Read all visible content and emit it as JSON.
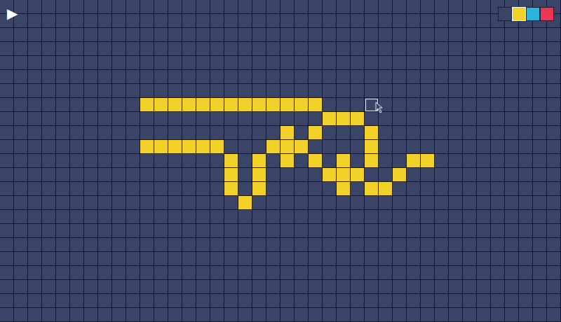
{
  "play_button": "▶",
  "palette": [
    {
      "color": "#3a4466",
      "selected": false
    },
    {
      "color": "#f2d12b",
      "selected": true
    },
    {
      "color": "#2bb5dc",
      "selected": false
    },
    {
      "color": "#ef3556",
      "selected": false
    }
  ],
  "grid": {
    "cols": 40,
    "rows": 23,
    "cells": [
      {
        "row": 7,
        "col": 10,
        "color": "#f2d12b"
      },
      {
        "row": 7,
        "col": 11,
        "color": "#f2d12b"
      },
      {
        "row": 7,
        "col": 12,
        "color": "#f2d12b"
      },
      {
        "row": 7,
        "col": 13,
        "color": "#f2d12b"
      },
      {
        "row": 7,
        "col": 14,
        "color": "#f2d12b"
      },
      {
        "row": 7,
        "col": 15,
        "color": "#f2d12b"
      },
      {
        "row": 7,
        "col": 16,
        "color": "#f2d12b"
      },
      {
        "row": 7,
        "col": 17,
        "color": "#f2d12b"
      },
      {
        "row": 7,
        "col": 18,
        "color": "#f2d12b"
      },
      {
        "row": 7,
        "col": 19,
        "color": "#f2d12b"
      },
      {
        "row": 7,
        "col": 20,
        "color": "#f2d12b"
      },
      {
        "row": 7,
        "col": 21,
        "color": "#f2d12b"
      },
      {
        "row": 7,
        "col": 22,
        "color": "#f2d12b"
      },
      {
        "row": 8,
        "col": 23,
        "color": "#f2d12b"
      },
      {
        "row": 8,
        "col": 24,
        "color": "#f2d12b"
      },
      {
        "row": 8,
        "col": 25,
        "color": "#f2d12b"
      },
      {
        "row": 9,
        "col": 20,
        "color": "#f2d12b"
      },
      {
        "row": 9,
        "col": 22,
        "color": "#f2d12b"
      },
      {
        "row": 9,
        "col": 26,
        "color": "#f2d12b"
      },
      {
        "row": 10,
        "col": 10,
        "color": "#f2d12b"
      },
      {
        "row": 10,
        "col": 11,
        "color": "#f2d12b"
      },
      {
        "row": 10,
        "col": 12,
        "color": "#f2d12b"
      },
      {
        "row": 10,
        "col": 13,
        "color": "#f2d12b"
      },
      {
        "row": 10,
        "col": 14,
        "color": "#f2d12b"
      },
      {
        "row": 10,
        "col": 15,
        "color": "#f2d12b"
      },
      {
        "row": 10,
        "col": 19,
        "color": "#f2d12b"
      },
      {
        "row": 10,
        "col": 20,
        "color": "#f2d12b"
      },
      {
        "row": 10,
        "col": 21,
        "color": "#f2d12b"
      },
      {
        "row": 10,
        "col": 26,
        "color": "#f2d12b"
      },
      {
        "row": 11,
        "col": 16,
        "color": "#f2d12b"
      },
      {
        "row": 11,
        "col": 18,
        "color": "#f2d12b"
      },
      {
        "row": 11,
        "col": 20,
        "color": "#f2d12b"
      },
      {
        "row": 11,
        "col": 22,
        "color": "#f2d12b"
      },
      {
        "row": 11,
        "col": 24,
        "color": "#f2d12b"
      },
      {
        "row": 11,
        "col": 26,
        "color": "#f2d12b"
      },
      {
        "row": 11,
        "col": 29,
        "color": "#f2d12b"
      },
      {
        "row": 11,
        "col": 30,
        "color": "#f2d12b"
      },
      {
        "row": 12,
        "col": 16,
        "color": "#f2d12b"
      },
      {
        "row": 12,
        "col": 18,
        "color": "#f2d12b"
      },
      {
        "row": 12,
        "col": 23,
        "color": "#f2d12b"
      },
      {
        "row": 12,
        "col": 24,
        "color": "#f2d12b"
      },
      {
        "row": 12,
        "col": 25,
        "color": "#f2d12b"
      },
      {
        "row": 12,
        "col": 28,
        "color": "#f2d12b"
      },
      {
        "row": 13,
        "col": 16,
        "color": "#f2d12b"
      },
      {
        "row": 13,
        "col": 18,
        "color": "#f2d12b"
      },
      {
        "row": 13,
        "col": 24,
        "color": "#f2d12b"
      },
      {
        "row": 13,
        "col": 26,
        "color": "#f2d12b"
      },
      {
        "row": 13,
        "col": 27,
        "color": "#f2d12b"
      },
      {
        "row": 14,
        "col": 17,
        "color": "#f2d12b"
      }
    ]
  },
  "cursor": {
    "row": 7,
    "col": 26
  }
}
